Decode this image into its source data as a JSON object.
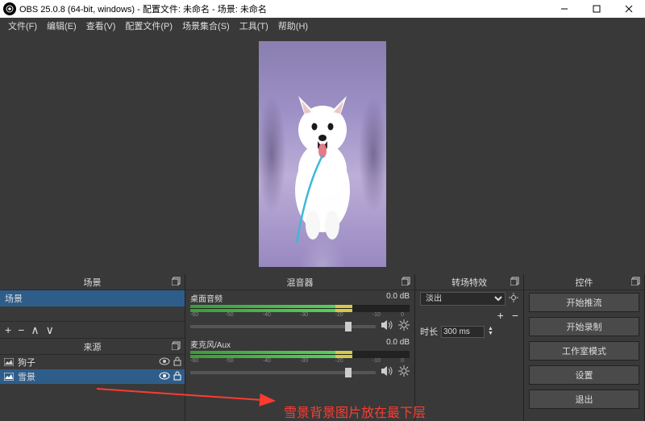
{
  "window": {
    "title": "OBS 25.0.8 (64-bit, windows) - 配置文件: 未命名 - 场景: 未命名"
  },
  "menubar": [
    {
      "label": "文件(F)"
    },
    {
      "label": "编辑(E)"
    },
    {
      "label": "查看(V)"
    },
    {
      "label": "配置文件(P)"
    },
    {
      "label": "场景集合(S)"
    },
    {
      "label": "工具(T)"
    },
    {
      "label": "帮助(H)"
    }
  ],
  "panels": {
    "scenes": {
      "title": "场景",
      "items": [
        "场景"
      ],
      "sources_title": "来源",
      "sources": [
        {
          "icon": "image",
          "label": "狗子",
          "visible": true,
          "locked": false
        },
        {
          "icon": "image",
          "label": "雪景",
          "visible": true,
          "locked": false
        }
      ]
    },
    "mixer": {
      "title": "混音器",
      "channels": [
        {
          "name": "桌面音频",
          "db": "0.0 dB"
        },
        {
          "name": "麦克风/Aux",
          "db": "0.0 dB"
        }
      ],
      "scale": [
        "-60",
        "-55",
        "-50",
        "-45",
        "-40",
        "-35",
        "-30",
        "-25",
        "-20",
        "-15",
        "-10",
        "-5",
        "0"
      ]
    },
    "transitions": {
      "title": "转场特效",
      "selected": "淡出",
      "duration_label": "时长",
      "duration_value": "300 ms"
    },
    "controls": {
      "title": "控件",
      "buttons": [
        "开始推流",
        "开始录制",
        "工作室模式",
        "设置",
        "退出"
      ]
    }
  },
  "annotation": {
    "text": "雪景背景图片放在最下层"
  }
}
